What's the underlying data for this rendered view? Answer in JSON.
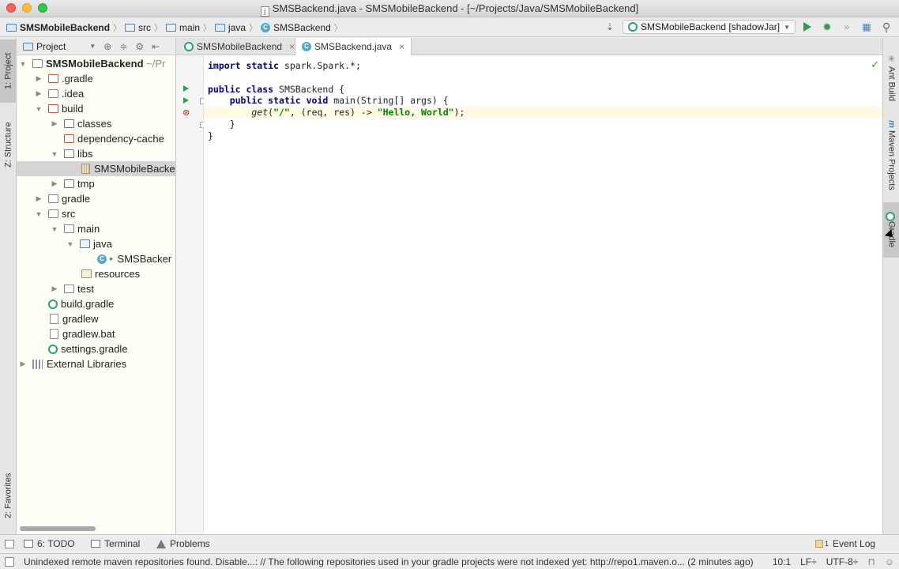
{
  "window": {
    "title": "SMSBackend.java - SMSMobileBackend - [~/Projects/Java/SMSMobileBackend]",
    "file_icon_letter": "j"
  },
  "navbar": {
    "breadcrumbs": [
      "SMSMobileBackend",
      "src",
      "main",
      "java",
      "SMSBackend"
    ],
    "run_config": "SMSMobileBackend [shadowJar]"
  },
  "left_strip": {
    "tabs": [
      "1: Project",
      "Z: Structure",
      "2: Favorites"
    ]
  },
  "project_panel": {
    "view_label": "Project",
    "tree": [
      {
        "label": "SMSMobileBackend",
        "suffix": "~/Pr",
        "bold": true
      },
      {
        "label": ".gradle"
      },
      {
        "label": ".idea"
      },
      {
        "label": "build"
      },
      {
        "label": "classes"
      },
      {
        "label": "dependency-cache"
      },
      {
        "label": "libs"
      },
      {
        "label": "SMSMobileBacke"
      },
      {
        "label": "tmp"
      },
      {
        "label": "gradle"
      },
      {
        "label": "src"
      },
      {
        "label": "main"
      },
      {
        "label": "java"
      },
      {
        "label": "SMSBacker"
      },
      {
        "label": "resources"
      },
      {
        "label": "test"
      },
      {
        "label": "build.gradle"
      },
      {
        "label": "gradlew"
      },
      {
        "label": "gradlew.bat"
      },
      {
        "label": "settings.gradle"
      },
      {
        "label": "External Libraries"
      }
    ]
  },
  "editor": {
    "tabs": [
      "SMSMobileBackend",
      "SMSBackend.java"
    ],
    "code": {
      "line1_kw": "import static",
      "line1_rest": " spark.Spark.*;",
      "line3_kw": "public class",
      "line3_rest": " SMSBackend {",
      "line4_kw": "public static void",
      "line4_rest": " main(String[] args) {",
      "line5_call": "get",
      "line5_a": "(",
      "line5_str1": "\"/\"",
      "line5_b": ", (req, res) -> ",
      "line5_str2": "\"Hello, World\"",
      "line5_c": ");",
      "line6": "}",
      "line7": "}"
    }
  },
  "right_strip": {
    "tabs": [
      "Ant Build",
      "Maven Projects",
      "Gradle"
    ]
  },
  "bottom_tools": {
    "todo": "6: TODO",
    "terminal": "Terminal",
    "problems": "Problems",
    "event_log": "Event Log",
    "event_count": "1"
  },
  "status_bar": {
    "message": "Unindexed remote maven repositories found. Disable...: // The following repositories used in your gradle projects were not indexed yet: http://repo1.maven.o... (2 minutes ago)",
    "position": "10:1",
    "line_sep": "LF÷",
    "encoding": "UTF-8÷"
  }
}
